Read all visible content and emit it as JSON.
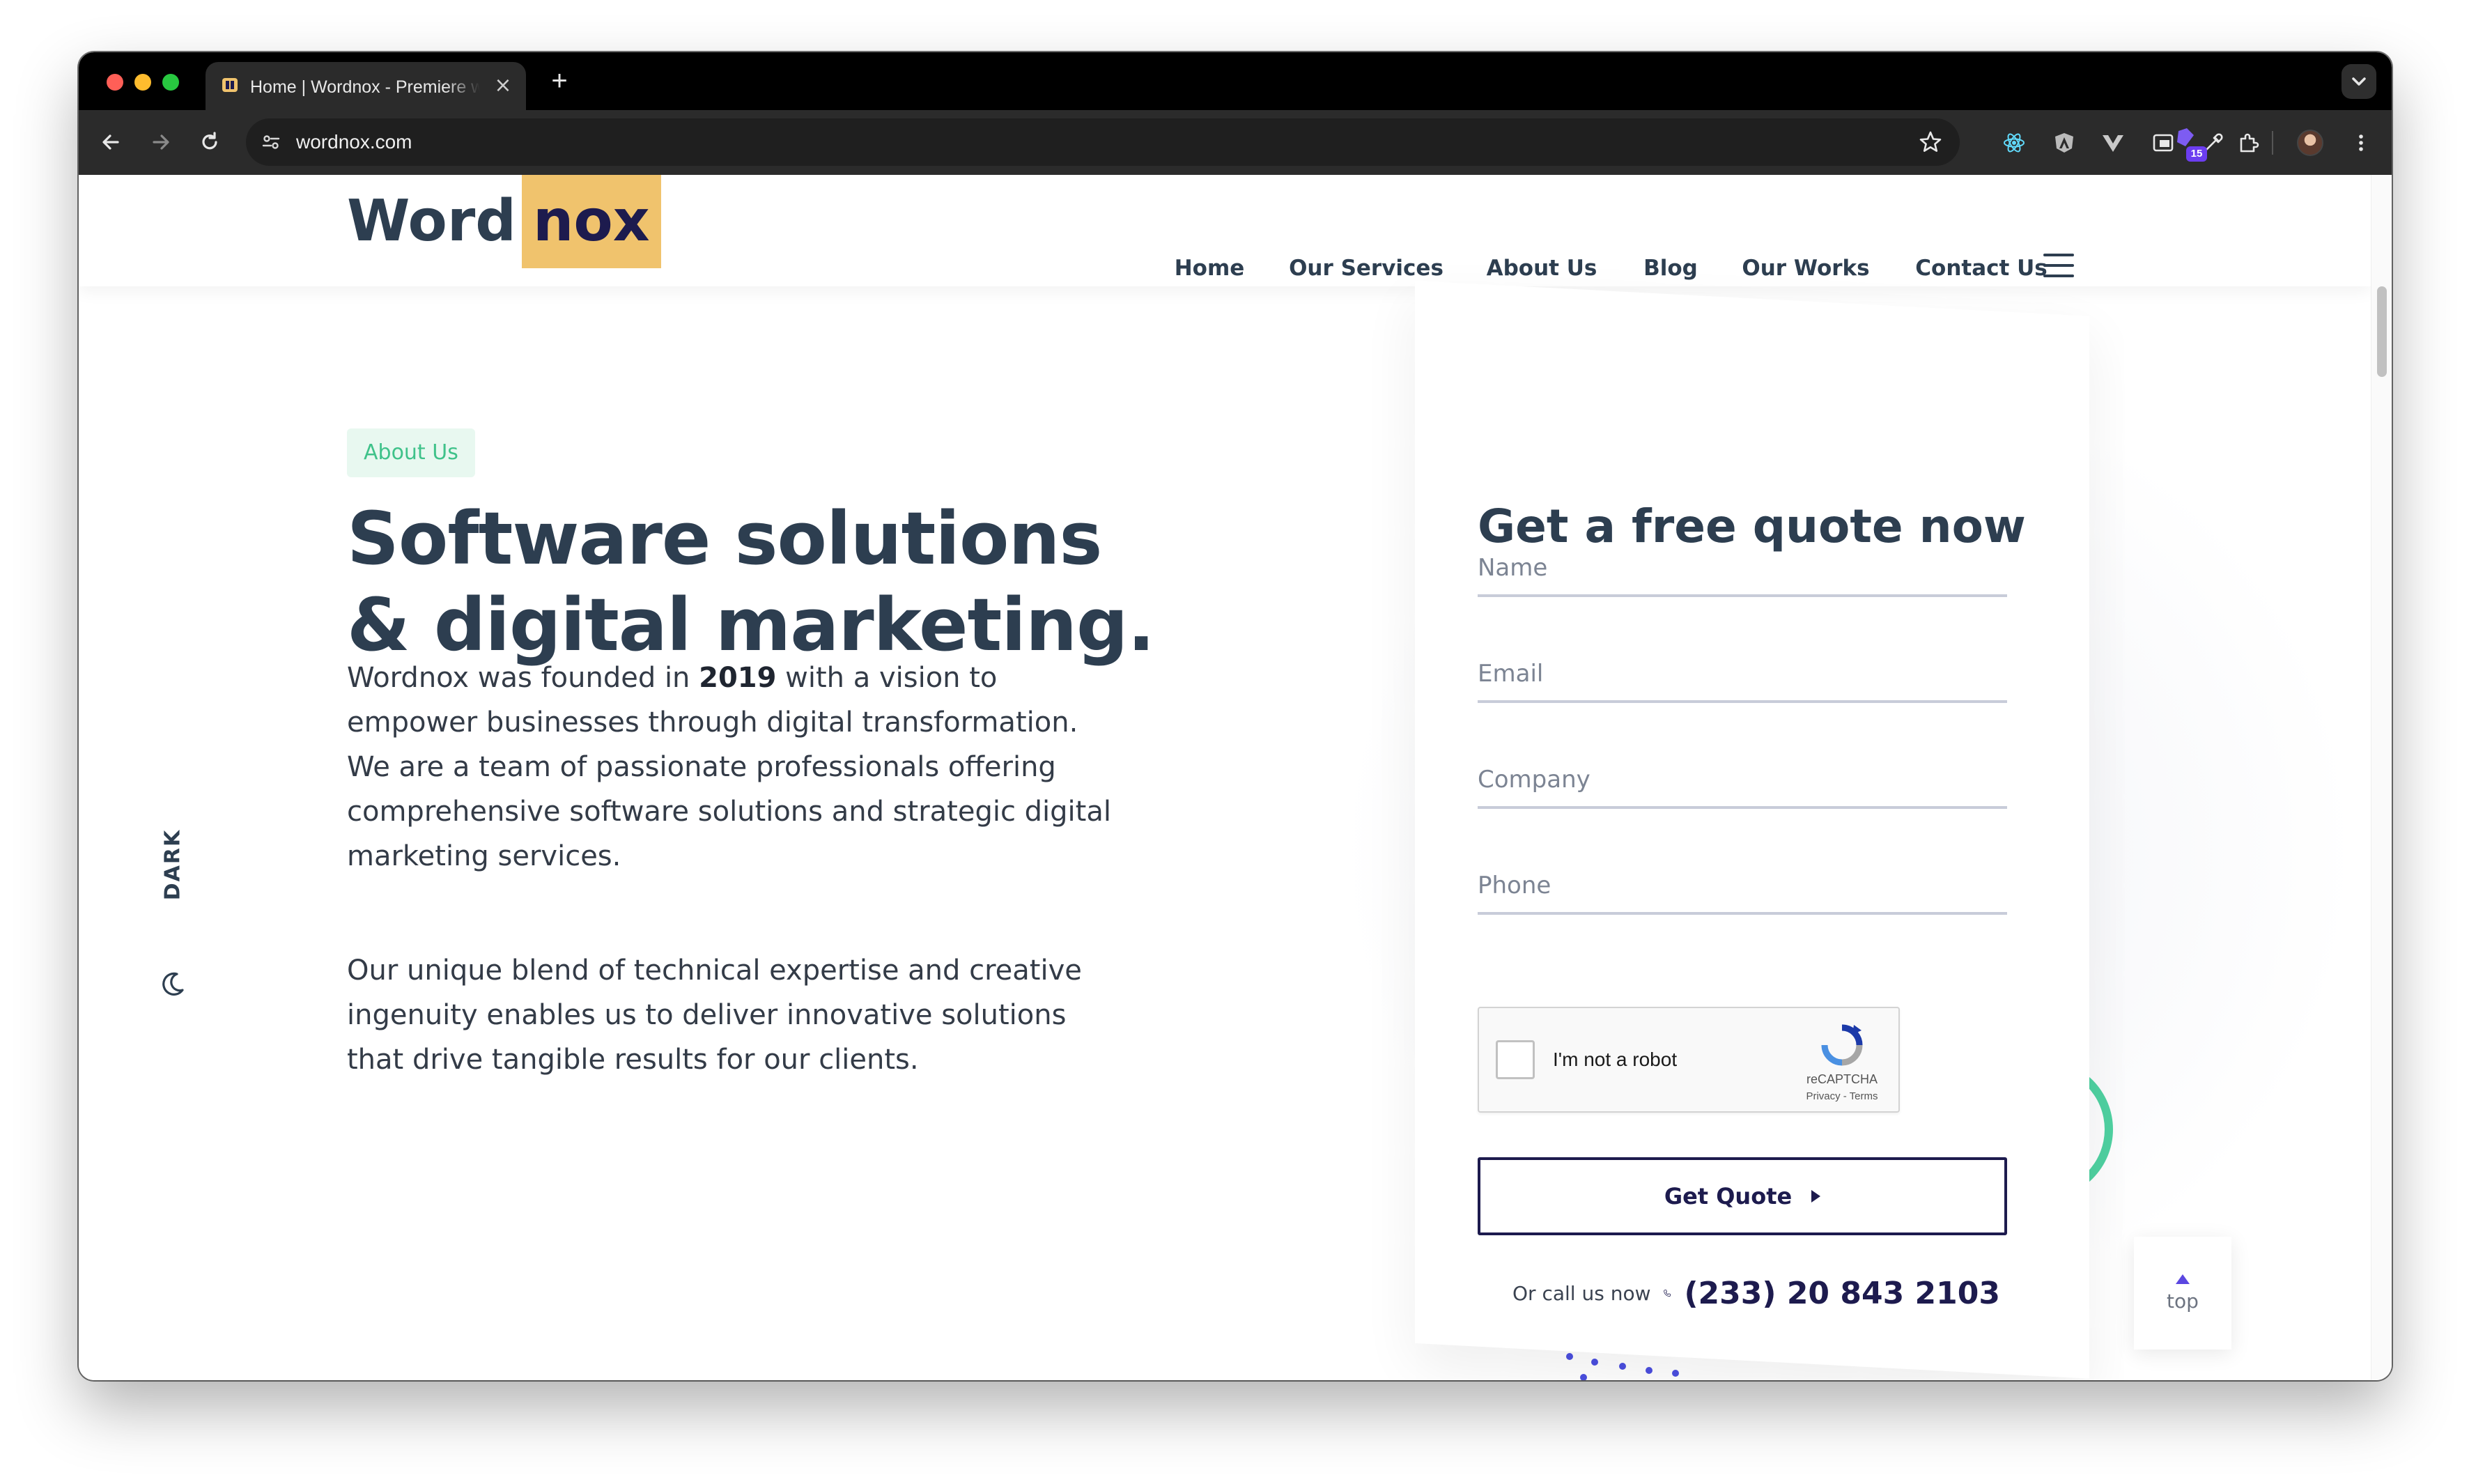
{
  "browser": {
    "tab_title": "Home | Wordnox - Premiere web",
    "url": "wordnox.com",
    "extension_badge": "15"
  },
  "site": {
    "logo_part1": "Word",
    "logo_part2": "nox",
    "nav": [
      "Home",
      "Our Services",
      "About Us",
      "Blog",
      "Our Works",
      "Contact Us"
    ],
    "dark_toggle_label": "DARK",
    "colors": {
      "heading": "#2d3e50",
      "logo_highlight": "#f0c36d",
      "navy": "#1d1b4e",
      "pill_bg": "#e8f8f0",
      "pill_text": "#3fc28a",
      "accent_purple": "#5b47e0"
    }
  },
  "hero": {
    "pill": "About Us",
    "headline": "Software solutions & digital marketing.",
    "p1_before": "Wordnox was founded in ",
    "p1_year": "2019",
    "p1_after": " with a vision to empower businesses through digital transformation. We are a team of passionate professionals offering comprehensive software solutions and strategic digital marketing services.",
    "p2": "Our unique blend of technical expertise and creative ingenuity enables us to deliver innovative solutions that drive tangible results for our clients."
  },
  "quote_form": {
    "title": "Get a free quote now",
    "fields": {
      "name_placeholder": "Name",
      "email_placeholder": "Email",
      "company_placeholder": "Company",
      "phone_placeholder": "Phone"
    },
    "recaptcha": {
      "label": "I'm not a robot",
      "brand": "reCAPTCHA",
      "terms": "Privacy - Terms"
    },
    "submit_label": "Get Quote",
    "call_label": "Or call us now",
    "phone_number": "(233) 20 843 2103"
  },
  "back_to_top": {
    "label": "top"
  }
}
